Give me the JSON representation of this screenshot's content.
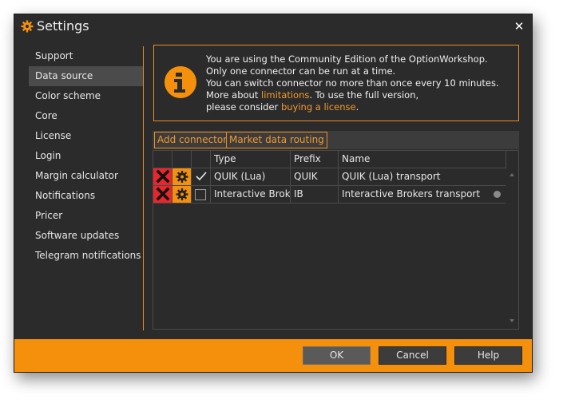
{
  "window": {
    "title": "Settings",
    "close_glyph": "✕"
  },
  "sidebar": {
    "items": [
      {
        "label": "Support",
        "active": false
      },
      {
        "label": "Data source",
        "active": true
      },
      {
        "label": "Color scheme",
        "active": false
      },
      {
        "label": "Core",
        "active": false
      },
      {
        "label": "License",
        "active": false
      },
      {
        "label": "Login",
        "active": false
      },
      {
        "label": "Margin calculator",
        "active": false
      },
      {
        "label": "Notifications",
        "active": false
      },
      {
        "label": "Pricer",
        "active": false
      },
      {
        "label": "Software updates",
        "active": false
      },
      {
        "label": "Telegram notifications",
        "active": false
      }
    ]
  },
  "info": {
    "line1": "You are using the Community Edition of the OptionWorkshop.",
    "line2": "Only one connector can be run at a time.",
    "line3": "You can switch connector no more than once every 10 minutes.",
    "line4_prefix": "More about ",
    "line4_link": "limitations",
    "line4_suffix": ". To use the full version,",
    "line5_prefix": "please consider ",
    "line5_link": "buying a license",
    "line5_suffix": "."
  },
  "toolbar": {
    "add_connector": "Add connector",
    "market_data_routing": "Market data routing"
  },
  "table": {
    "headers": {
      "type": "Type",
      "prefix": "Prefix",
      "name": "Name"
    },
    "rows": [
      {
        "type": "QUIK (Lua)",
        "prefix": "QUIK",
        "name": "QUIK (Lua) transport",
        "checked": true
      },
      {
        "type": "Interactive Brok...",
        "prefix": "IB",
        "name": "Interactive Brokers transport",
        "checked": false
      }
    ]
  },
  "footer": {
    "ok": "OK",
    "cancel": "Cancel",
    "help": "Help"
  },
  "colors": {
    "accent": "#f4900c",
    "delete": "#e8262b",
    "background": "#2b2b2b"
  },
  "icons": [
    "gear-icon",
    "close-icon",
    "info-icon",
    "delete-x-icon",
    "settings-gear-icon",
    "check-icon",
    "scroll-up-icon",
    "scroll-down-icon"
  ]
}
